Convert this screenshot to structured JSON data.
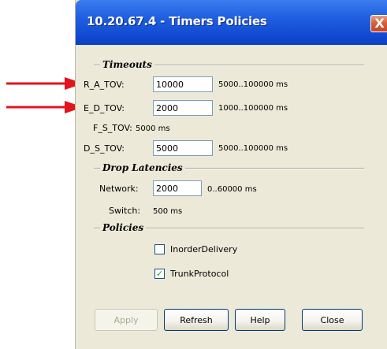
{
  "window": {
    "title": "10.20.67.4 - Timers Policies",
    "close_glyph": "X"
  },
  "timeouts": {
    "title": "Timeouts",
    "ra_tov": {
      "label": "R_A_TOV:",
      "value": "10000",
      "range": "5000..100000 ms"
    },
    "ed_tov": {
      "label": "E_D_TOV:",
      "value": "2000",
      "range": "1000..100000 ms"
    },
    "fs_tov": {
      "label": "F_S_TOV:",
      "value": "5000 ms"
    },
    "ds_tov": {
      "label": "D_S_TOV:",
      "value": "5000",
      "range": "5000..100000 ms"
    }
  },
  "drop_latencies": {
    "title": "Drop Latencies",
    "network": {
      "label": "Network:",
      "value": "2000",
      "range": "0..60000 ms"
    },
    "switch": {
      "label": "Switch:",
      "value": "500 ms"
    }
  },
  "policies": {
    "title": "Policies",
    "inorder_delivery": {
      "label": "InorderDelivery",
      "checked": false
    },
    "trunk_protocol": {
      "label": "TrunkProtocol",
      "checked": true,
      "check_glyph": "✓"
    }
  },
  "buttons": {
    "apply": "Apply",
    "refresh": "Refresh",
    "help": "Help",
    "close": "Close"
  },
  "annotations": {
    "arrow_color": "#e3141b"
  },
  "colors": {
    "titlebar": "#1f5fe0",
    "window_bg": "#ece9d8",
    "close_button": "#d95f3a"
  }
}
